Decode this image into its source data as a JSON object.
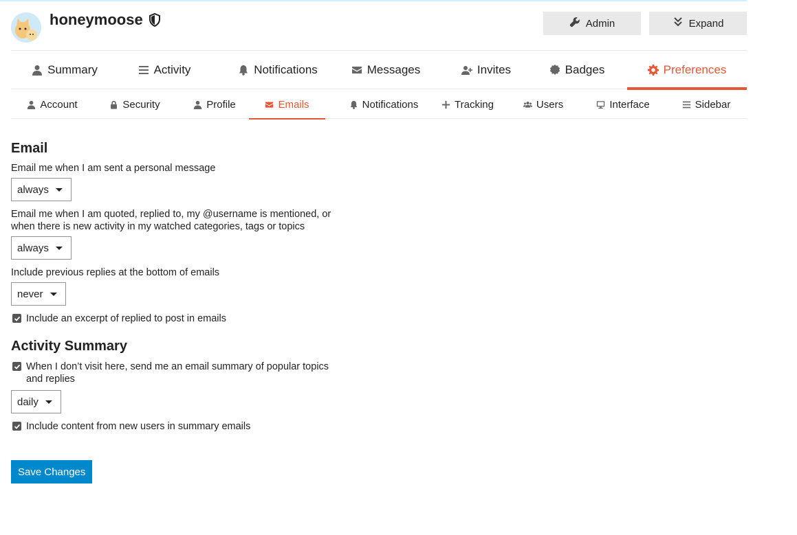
{
  "user": {
    "name": "honeymoose"
  },
  "header_buttons": {
    "admin": "Admin",
    "expand": "Expand"
  },
  "main_tabs": [
    {
      "label": "Summary",
      "icon": "user-icon"
    },
    {
      "label": "Activity",
      "icon": "list-icon"
    },
    {
      "label": "Notifications",
      "icon": "bell-icon"
    },
    {
      "label": "Messages",
      "icon": "envelope-icon"
    },
    {
      "label": "Invites",
      "icon": "user-plus-icon"
    },
    {
      "label": "Badges",
      "icon": "certificate-icon"
    },
    {
      "label": "Preferences",
      "icon": "gear-icon",
      "active": true
    }
  ],
  "pref_tabs": [
    {
      "label": "Account",
      "icon": "user-icon"
    },
    {
      "label": "Security",
      "icon": "lock-icon"
    },
    {
      "label": "Profile",
      "icon": "user-icon"
    },
    {
      "label": "Emails",
      "icon": "envelope-icon",
      "active": true
    },
    {
      "label": "Notifications",
      "icon": "bell-icon"
    },
    {
      "label": "Tracking",
      "icon": "plus-icon"
    },
    {
      "label": "Users",
      "icon": "users-icon"
    },
    {
      "label": "Interface",
      "icon": "desktop-icon"
    },
    {
      "label": "Sidebar",
      "icon": "bars-icon"
    }
  ],
  "email_section": {
    "heading": "Email",
    "personal_message": {
      "label": "Email me when I am sent a personal message",
      "value": "always"
    },
    "mentions": {
      "label": "Email me when I am quoted, replied to, my @username is mentioned, or when there is new activity in my watched categories, tags or topics",
      "value": "always"
    },
    "previous_replies": {
      "label": "Include previous replies at the bottom of emails",
      "value": "never"
    },
    "excerpt": {
      "label": "Include an excerpt of replied to post in emails",
      "checked": true
    }
  },
  "activity_section": {
    "heading": "Activity Summary",
    "digest": {
      "label": "When I don’t visit here, send me an email summary of popular topics and replies",
      "checked": true
    },
    "frequency": {
      "value": "daily"
    },
    "new_users": {
      "label": "Include content from new users in summary emails",
      "checked": true
    }
  },
  "save_button": "Save Changes",
  "colors": {
    "accent": "#e45735",
    "primary": "#0088cc",
    "button_bg": "#e9e9e9"
  }
}
